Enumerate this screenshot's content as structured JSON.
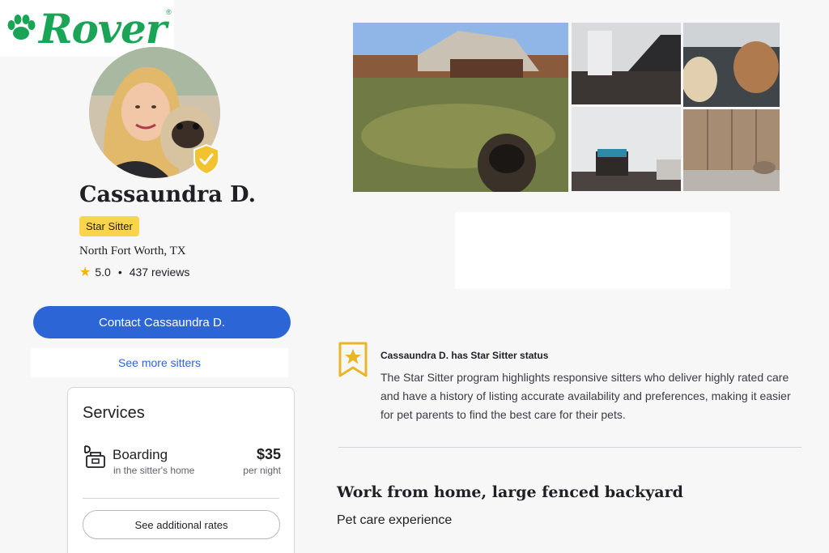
{
  "brand": {
    "name": "Rover",
    "registered_mark": "®",
    "color": "#1aa556"
  },
  "profile": {
    "name": "Cassaundra D.",
    "badge": "Star Sitter",
    "location": "North Fort Worth, TX",
    "rating": "5.0",
    "separator": "•",
    "reviews": "437 reviews",
    "verified_icon": "shield-check-icon"
  },
  "actions": {
    "contact_label": "Contact Cassaundra D.",
    "see_more_label": "See more sitters"
  },
  "services": {
    "title": "Services",
    "items": [
      {
        "name": "Boarding",
        "subtitle": "in the sitter's home",
        "price": "$35",
        "unit": "per night",
        "icon": "boarding-icon"
      }
    ],
    "rates_label": "See additional rates"
  },
  "star_status": {
    "icon": "star-ribbon-icon",
    "title": "Cassaundra D. has Star Sitter status",
    "body": "The Star Sitter program highlights responsive sitters who deliver highly rated care and have a history of listing accurate availability and preferences, making it easier for pet parents to find the best care for their pets."
  },
  "listing": {
    "headline": "Work from home, large fenced backyard",
    "subheading": "Pet care experience"
  },
  "colors": {
    "primary": "#2c66d6",
    "badge": "#fcd34d",
    "star": "#f5b400"
  }
}
